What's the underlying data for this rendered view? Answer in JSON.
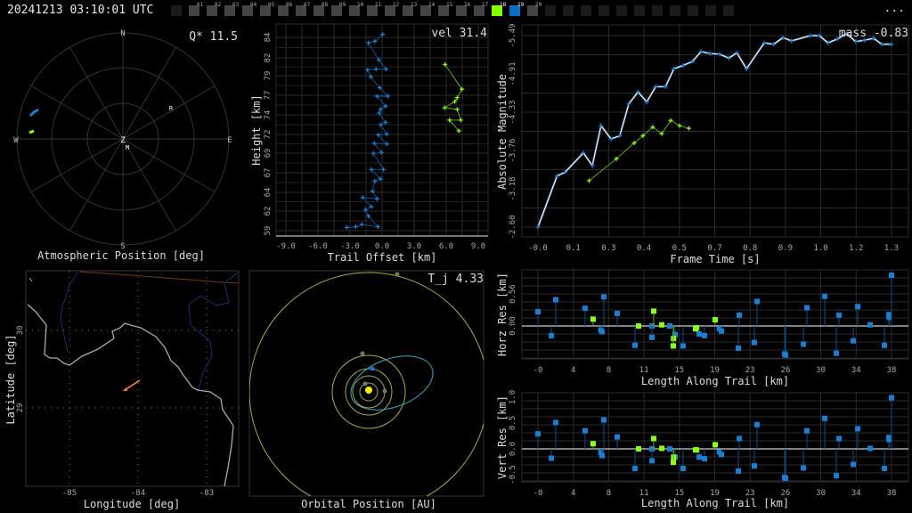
{
  "header": {
    "timestamp": "20241213 03:10:01 UTC",
    "menu_label": "...",
    "frames": [
      "01",
      "02",
      "03",
      "04",
      "05",
      "06",
      "07",
      "08",
      "09",
      "10",
      "11",
      "12",
      "13",
      "14",
      "15",
      "16",
      "17",
      "18",
      "19",
      "20"
    ],
    "highlighted": {
      "18": "#7fff00",
      "19": "#0a6fc2"
    }
  },
  "colors": {
    "primary": "#1a7fd0",
    "secondary": "#8aff1a",
    "grid": "#2c2c2c",
    "orbit": "#a7a84c",
    "sun": "#ffee00",
    "trail": "#ff8a3c"
  },
  "polar": {
    "title": "Atmospheric Position [deg]",
    "metric": "Q* 11.5",
    "labels": {
      "n": "N",
      "s": "S",
      "e": "E",
      "w": "W",
      "z": "Z",
      "r": "R",
      "m": "M"
    }
  },
  "height_plot": {
    "metric": "vel 31.4",
    "xlabel": "Trail Offset [km]",
    "ylabel": "Height [km]",
    "xticks": [
      "-9.0",
      "-6.0",
      "-3.0",
      "0.0",
      "3.0",
      "6.0",
      "9.0"
    ],
    "yticks": [
      "84",
      "82",
      "79",
      "77",
      "74",
      "72",
      "69",
      "67",
      "64",
      "62",
      "59"
    ]
  },
  "magnitude_plot": {
    "metric": "mass -0.83",
    "xlabel": "Frame Time [s]",
    "ylabel": "Absolute Magnitude",
    "xticks": [
      "-0.0",
      "0.1",
      "0.3",
      "0.4",
      "0.5",
      "0.7",
      "0.8",
      "0.9",
      "1.0",
      "1.2",
      "1.3"
    ],
    "yticks": [
      "-5.49",
      "-4.91",
      "-4.33",
      "-3.76",
      "-3.18",
      "-2.60"
    ]
  },
  "horz_plot": {
    "xlabel": "Length Along Trail [km]",
    "ylabel": "Horz Res [km]",
    "xticks": [
      "-0",
      "4",
      "8",
      "11",
      "15",
      "19",
      "23",
      "26",
      "30",
      "34",
      "38"
    ],
    "yticks": [
      "0.56",
      "0.00"
    ]
  },
  "vert_plot": {
    "xlabel": "Length Along Trail [km]",
    "ylabel": "Vert Res [km]",
    "xticks": [
      "-0",
      "4",
      "8",
      "11",
      "15",
      "19",
      "23",
      "26",
      "30",
      "34",
      "38"
    ],
    "yticks": [
      "1.0",
      "0.5",
      "0.0",
      "-0.5"
    ]
  },
  "map": {
    "xlabel": "Longitude [deg]",
    "ylabel": "Latitude [deg]",
    "xticks": [
      "-85",
      "-84",
      "-83"
    ],
    "yticks": [
      "30",
      "29"
    ]
  },
  "orbit": {
    "metric": "T_j 4.33",
    "xlabel": "Orbital Position [AU]"
  },
  "chart_data": [
    {
      "type": "line",
      "name": "height",
      "xlabel": "Trail Offset [km]",
      "ylabel": "Height [km]",
      "xlim": [
        -9,
        9
      ],
      "ylim": [
        59,
        84
      ],
      "series": [
        {
          "name": "camera-1",
          "color": "#1a7fd0",
          "points": [
            [
              0.06,
              84.4
            ],
            [
              -0.67,
              83.5
            ],
            [
              -1.28,
              83.3
            ],
            [
              -0.31,
              81.1
            ],
            [
              0.36,
              79.9
            ],
            [
              -0.56,
              79.9
            ],
            [
              -1.36,
              79.8
            ],
            [
              -1.06,
              78.9
            ],
            [
              -0.22,
              77.5
            ],
            [
              0.53,
              76.4
            ],
            [
              -0.47,
              76.4
            ],
            [
              0.33,
              75.1
            ],
            [
              -0.14,
              74.7
            ],
            [
              -0.28,
              74.2
            ],
            [
              0.33,
              73.0
            ],
            [
              -0.14,
              72.7
            ],
            [
              0.44,
              71.5
            ],
            [
              -0.36,
              71.4
            ],
            [
              0.44,
              70.2
            ],
            [
              -0.72,
              70.3
            ],
            [
              -0.06,
              69.1
            ],
            [
              -0.81,
              69.0
            ],
            [
              0.14,
              66.9
            ],
            [
              -1.0,
              66.9
            ],
            [
              -0.14,
              65.7
            ],
            [
              -0.69,
              65.4
            ],
            [
              -0.89,
              64.1
            ],
            [
              -0.47,
              63.1
            ],
            [
              -1.81,
              63.3
            ],
            [
              -1.0,
              62.1
            ],
            [
              -1.56,
              61.7
            ],
            [
              -1.28,
              60.9
            ],
            [
              -0.39,
              59.5
            ],
            [
              -1.89,
              59.8
            ],
            [
              -2.47,
              59.5
            ],
            [
              -3.31,
              59.4
            ]
          ]
        },
        {
          "name": "camera-2",
          "color": "#8aff1a",
          "points": [
            [
              5.89,
              80.5
            ],
            [
              7.47,
              77.3
            ],
            [
              7.03,
              76.2
            ],
            [
              6.81,
              75.7
            ],
            [
              5.86,
              74.9
            ],
            [
              7.03,
              74.7
            ],
            [
              7.36,
              73.3
            ],
            [
              6.31,
              73.3
            ],
            [
              7.19,
              71.9
            ]
          ]
        }
      ]
    },
    {
      "type": "line",
      "name": "magnitude",
      "xlabel": "Frame Time [s]",
      "ylabel": "Absolute Magnitude",
      "xlim": [
        0,
        1.3
      ],
      "ylim": [
        -2.6,
        -5.49
      ],
      "series": [
        {
          "name": "camera-1",
          "color": "#1a7fd0",
          "points": [
            [
              0,
              -2.6
            ],
            [
              0.07,
              -3.37
            ],
            [
              0.1,
              -3.43
            ],
            [
              0.167,
              -3.72
            ],
            [
              0.2,
              -3.53
            ],
            [
              0.232,
              -4.13
            ],
            [
              0.269,
              -3.93
            ],
            [
              0.301,
              -3.98
            ],
            [
              0.334,
              -4.46
            ],
            [
              0.368,
              -4.64
            ],
            [
              0.4,
              -4.49
            ],
            [
              0.433,
              -4.72
            ],
            [
              0.469,
              -4.72
            ],
            [
              0.5,
              -4.99
            ],
            [
              0.534,
              -5.04
            ],
            [
              0.568,
              -5.1
            ],
            [
              0.6,
              -5.25
            ],
            [
              0.632,
              -5.22
            ],
            [
              0.668,
              -5.21
            ],
            [
              0.702,
              -5.15
            ],
            [
              0.731,
              -5.23
            ],
            [
              0.767,
              -4.99
            ],
            [
              0.832,
              -5.38
            ],
            [
              0.867,
              -5.36
            ],
            [
              0.901,
              -5.46
            ],
            [
              0.932,
              -5.41
            ],
            [
              1.001,
              -5.49
            ],
            [
              1.035,
              -5.49
            ],
            [
              1.066,
              -5.38
            ],
            [
              1.101,
              -5.44
            ],
            [
              1.135,
              -5.52
            ],
            [
              1.168,
              -5.4
            ],
            [
              1.2,
              -5.42
            ],
            [
              1.234,
              -5.45
            ],
            [
              1.264,
              -5.36
            ],
            [
              1.3,
              -5.36
            ]
          ]
        },
        {
          "name": "camera-2",
          "color": "#8aff1a",
          "points": [
            [
              0.188,
              -3.3
            ],
            [
              0.288,
              -3.63
            ],
            [
              0.354,
              -3.87
            ],
            [
              0.386,
              -3.98
            ],
            [
              0.422,
              -4.11
            ],
            [
              0.455,
              -4.01
            ],
            [
              0.488,
              -4.21
            ],
            [
              0.521,
              -4.13
            ],
            [
              0.555,
              -4.09
            ]
          ]
        }
      ]
    },
    {
      "type": "scatter",
      "name": "horz_res",
      "xlabel": "Length Along Trail [km]",
      "ylabel": "Horz Res [km]",
      "xlim": [
        0,
        38
      ],
      "series": [
        {
          "name": "camera-1",
          "color": "#1a7fd0",
          "points": [
            [
              0,
              0.25
            ],
            [
              1.44,
              -0.17
            ],
            [
              1.91,
              0.46
            ],
            [
              5.07,
              0.31
            ],
            [
              6.76,
              -0.07
            ],
            [
              6.89,
              -0.1
            ],
            [
              7.08,
              0.51
            ],
            [
              8.52,
              0.22
            ],
            [
              10.43,
              -0.34
            ],
            [
              12.25,
              0
            ],
            [
              12.25,
              -0.2
            ],
            [
              14.17,
              0
            ],
            [
              14.74,
              -0.15
            ],
            [
              15.6,
              -0.35
            ],
            [
              17.33,
              -0.14
            ],
            [
              17.9,
              -0.17
            ],
            [
              19.5,
              -0.05
            ],
            [
              19.72,
              -0.09
            ],
            [
              21.54,
              -0.39
            ],
            [
              21.64,
              0.19
            ],
            [
              23.26,
              -0.29
            ],
            [
              23.55,
              0.43
            ],
            [
              26.52,
              -0.49
            ],
            [
              26.61,
              -0.51
            ],
            [
              28.53,
              -0.32
            ],
            [
              28.91,
              0.32
            ],
            [
              30.83,
              0.52
            ],
            [
              32.07,
              -0.48
            ],
            [
              32.36,
              0.19
            ],
            [
              33.89,
              -0.26
            ],
            [
              34.37,
              0.34
            ],
            [
              35.7,
              0.02
            ],
            [
              37.24,
              -0.34
            ],
            [
              37.72,
              0.2
            ],
            [
              37.75,
              0.15
            ],
            [
              38,
              0.89
            ]
          ]
        },
        {
          "name": "camera-2",
          "color": "#8aff1a",
          "points": [
            [
              5.93,
              0.12
            ],
            [
              10.82,
              0
            ],
            [
              12.44,
              0.26
            ],
            [
              13.31,
              0.02
            ],
            [
              14.58,
              -0.22
            ],
            [
              14.55,
              -0.35
            ],
            [
              16.94,
              -0.05
            ],
            [
              17.04,
              -0.03
            ],
            [
              19.05,
              0.11
            ]
          ]
        }
      ]
    },
    {
      "type": "scatter",
      "name": "vert_res",
      "xlabel": "Length Along Trail [km]",
      "ylabel": "Vert Res [km]",
      "xlim": [
        0,
        38
      ],
      "series": [
        {
          "name": "camera-1",
          "color": "#1a7fd0",
          "points": [
            [
              0,
              0.29
            ],
            [
              1.44,
              -0.18
            ],
            [
              1.91,
              0.51
            ],
            [
              5.07,
              0.35
            ],
            [
              6.76,
              -0.07
            ],
            [
              6.89,
              -0.13
            ],
            [
              7.08,
              0.56
            ],
            [
              8.52,
              0.23
            ],
            [
              10.43,
              -0.38
            ],
            [
              12.25,
              0
            ],
            [
              12.25,
              -0.23
            ],
            [
              14.17,
              0
            ],
            [
              14.74,
              -0.16
            ],
            [
              15.6,
              -0.38
            ],
            [
              17.33,
              -0.16
            ],
            [
              17.9,
              -0.19
            ],
            [
              19.5,
              -0.06
            ],
            [
              19.72,
              -0.11
            ],
            [
              21.54,
              -0.43
            ],
            [
              21.64,
              0.2
            ],
            [
              23.26,
              -0.33
            ],
            [
              23.55,
              0.47
            ],
            [
              26.52,
              -0.55
            ],
            [
              26.61,
              -0.57
            ],
            [
              28.53,
              -0.37
            ],
            [
              28.91,
              0.35
            ],
            [
              30.83,
              0.59
            ],
            [
              32.07,
              -0.52
            ],
            [
              32.36,
              0.2
            ],
            [
              33.89,
              -0.3
            ],
            [
              34.37,
              0.39
            ],
            [
              35.7,
              0.01
            ],
            [
              37.24,
              -0.38
            ],
            [
              37.72,
              0.22
            ],
            [
              37.75,
              0.18
            ],
            [
              38,
              0.99
            ]
          ]
        },
        {
          "name": "camera-2",
          "color": "#8aff1a",
          "points": [
            [
              5.93,
              0.1
            ],
            [
              10.82,
              0
            ],
            [
              12.44,
              0.2
            ],
            [
              13.31,
              0.01
            ],
            [
              14.58,
              -0.16
            ],
            [
              14.55,
              -0.26
            ],
            [
              16.94,
              -0.02
            ],
            [
              17.04,
              -0.02
            ],
            [
              19.05,
              0.08
            ]
          ]
        }
      ]
    }
  ]
}
